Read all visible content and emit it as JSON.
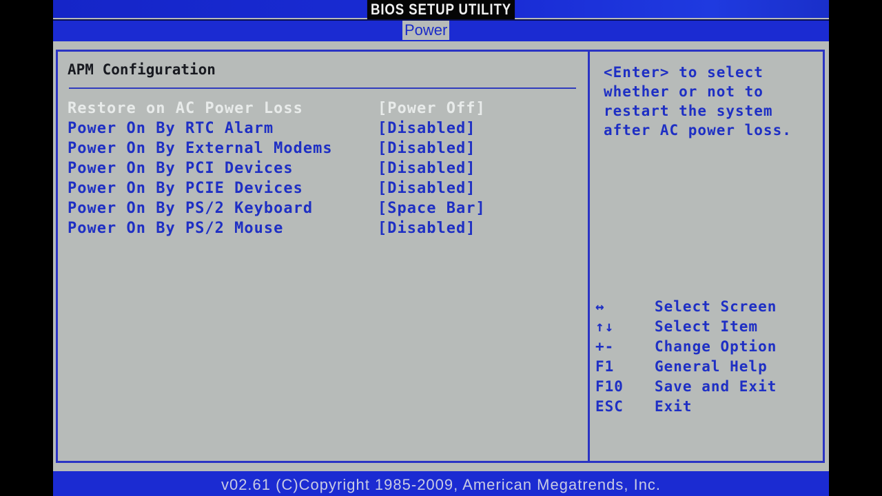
{
  "header": {
    "title": "BIOS SETUP UTILITY",
    "active_tab": "Power"
  },
  "colors": {
    "accent_blue": "#1b2bd2",
    "panel_gray": "#b7bbb9",
    "text_blue": "#1e2fc4",
    "selected_text": "#e8ebea"
  },
  "main": {
    "section_title": "APM Configuration",
    "settings": [
      {
        "label": "Restore on AC Power Loss",
        "value": "[Power Off]",
        "selected": true
      },
      {
        "label": "Power On By RTC Alarm",
        "value": "[Disabled]",
        "selected": false
      },
      {
        "label": "Power On By External Modems",
        "value": "[Disabled]",
        "selected": false
      },
      {
        "label": "Power On By PCI Devices",
        "value": "[Disabled]",
        "selected": false
      },
      {
        "label": "Power On By PCIE Devices",
        "value": "[Disabled]",
        "selected": false
      },
      {
        "label": "Power On By PS/2 Keyboard",
        "value": "[Space Bar]",
        "selected": false
      },
      {
        "label": "Power On By PS/2 Mouse",
        "value": "[Disabled]",
        "selected": false
      }
    ]
  },
  "help": {
    "lines": [
      "<Enter> to select",
      "whether or not to",
      "restart the system",
      "after AC power loss."
    ],
    "keys": [
      {
        "key": "↔",
        "icon": "left-right-arrow-icon",
        "desc": "Select Screen"
      },
      {
        "key": "↑↓",
        "icon": "up-down-arrow-icon",
        "desc": "Select Item"
      },
      {
        "key": "+-",
        "icon": "plus-minus-icon",
        "desc": "Change Option"
      },
      {
        "key": "F1",
        "icon": "",
        "desc": "General Help"
      },
      {
        "key": "F10",
        "icon": "",
        "desc": "Save and Exit"
      },
      {
        "key": "ESC",
        "icon": "",
        "desc": "Exit"
      }
    ]
  },
  "footer": {
    "text": "v02.61 (C)Copyright 1985-2009, American Megatrends, Inc."
  }
}
